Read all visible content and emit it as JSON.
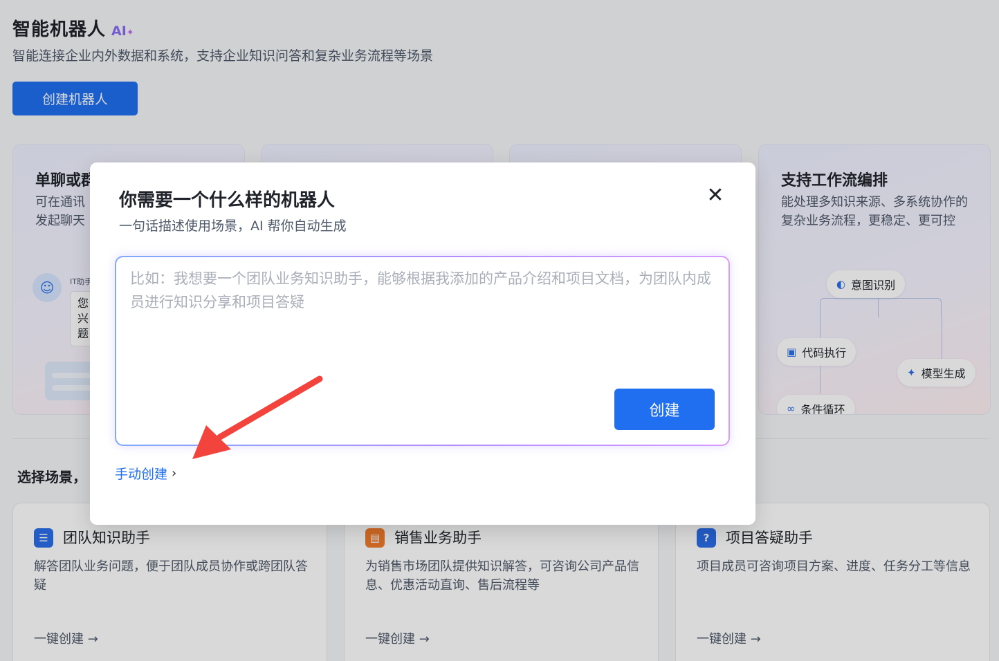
{
  "page": {
    "title": "智能机器人",
    "ai_badge": "AI",
    "subtitle": "智能连接企业内外数据和系统，支持企业知识问答和复杂业务流程等场景",
    "create_button": "创建机器人"
  },
  "features": [
    {
      "title": "单聊或群",
      "desc": "可在通讯\n发起聊天",
      "chat_name": "IT助手",
      "chat_text": "您\n兴\n题"
    },
    {
      "title": "支持工作流编排",
      "desc": "能处理多知识来源、多系统协作的复杂业务流程，更稳定、更可控",
      "nodes": {
        "intent": "意图识别",
        "code": "代码执行",
        "model": "模型生成",
        "loop": "条件循环"
      }
    }
  ],
  "section": {
    "title": "选择场景，"
  },
  "scenes": [
    {
      "icon": "list-icon",
      "icon_color": "#2b6ee8",
      "title": "团队知识助手",
      "desc": "解答团队业务问题，便于团队成员协作或跨团队答疑",
      "action": "一键创建 →"
    },
    {
      "icon": "briefcase-icon",
      "icon_color": "#f07b2b",
      "title": "销售业务助手",
      "desc": "为销售市场团队提供知识解答，可咨询公司产品信息、优惠活动直询、售后流程等",
      "action": "一键创建 →"
    },
    {
      "icon": "question-icon",
      "icon_color": "#2b6ee8",
      "title": "项目答疑助手",
      "desc": "项目成员可咨询项目方案、进度、任务分工等信息",
      "action": "一键创建 →"
    }
  ],
  "modal": {
    "title": "你需要一个什么样的机器人",
    "subtitle": "一句话描述使用场景，AI 帮你自动生成",
    "close_icon": "close-icon",
    "placeholder": "比如：我想要一个团队业务知识助手，能够根据我添加的产品介绍和项目文档，为团队内成员进行知识分享和项目答疑",
    "submit_label": "创建",
    "manual_link": "手动创建"
  },
  "colors": {
    "primary": "#1f6ff0",
    "arrow": "#f2443c"
  }
}
